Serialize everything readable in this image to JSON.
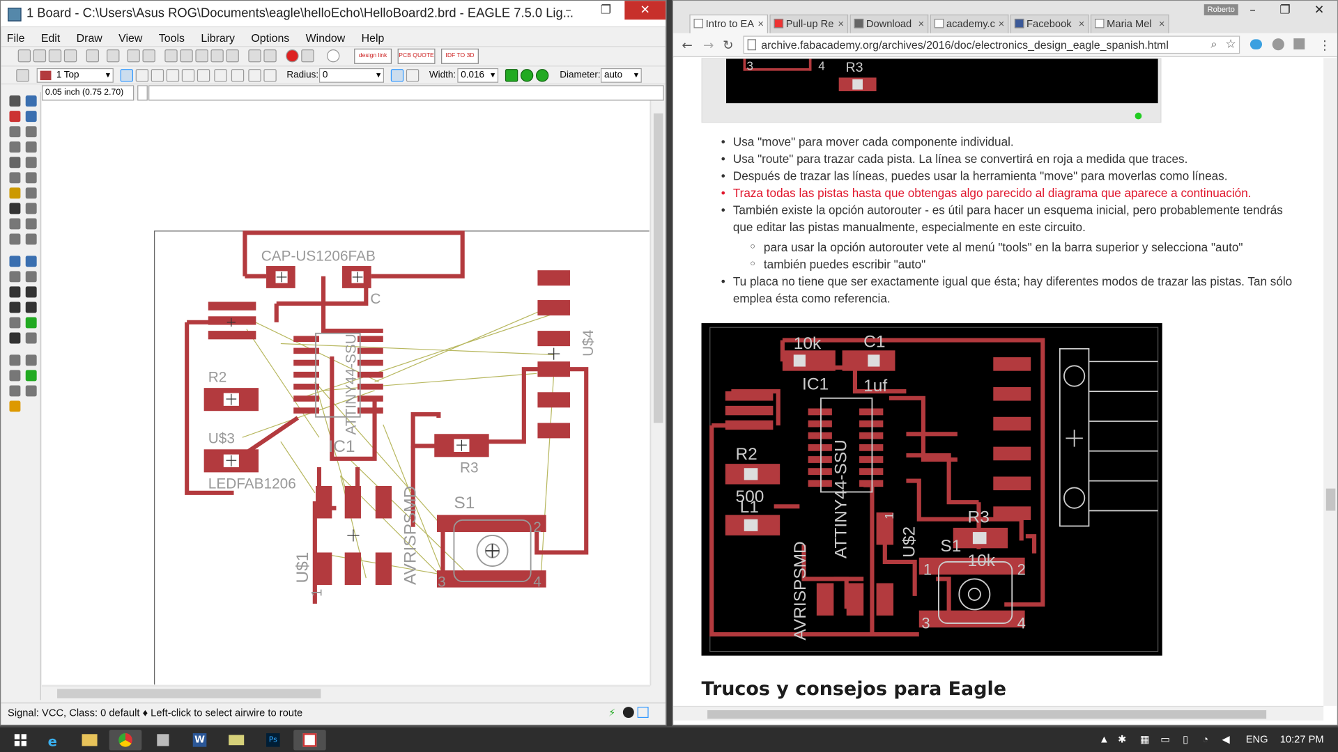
{
  "eagle": {
    "title": "1 Board - C:\\Users\\Asus ROG\\Documents\\eagle\\helloEcho\\HelloBoard2.brd - EAGLE 7.5.0 Lig...",
    "menu": [
      "File",
      "Edit",
      "Draw",
      "View",
      "Tools",
      "Library",
      "Options",
      "Window",
      "Help"
    ],
    "toolbar_buttons": [
      "design link",
      "PCB QUOTE",
      "IDF TO 3D"
    ],
    "layer": "1 Top",
    "radius_label": "Radius:",
    "radius_value": "0",
    "width_label": "Width:",
    "width_value": "0.016",
    "diameter_label": "Diameter:",
    "diameter_value": "auto",
    "coord": "0.05 inch (0.75 2.70)",
    "status": "Signal: VCC, Class: 0 default  ♦ Left-click to select airwire to route",
    "board_labels": {
      "cap_name": "CAP-US1206FAB",
      "c_name": "C",
      "r2": "R2",
      "u3": "U$3",
      "led": "LEDFAB1206",
      "ic1": "IC1",
      "attiny": "ATTINY44-SSU",
      "u4": "U$4",
      "r3": "R3",
      "s1": "S1",
      "avr": "AVRISPSMD",
      "u1": "U$1",
      "one": "1",
      "pin2": "2",
      "pin3": "3",
      "pin4": "4"
    },
    "colors": {
      "trace": "#b33a3e",
      "airwire": "#b8b860"
    }
  },
  "chrome": {
    "tabs": [
      {
        "label": "Intro to EA",
        "active": true,
        "fav": "page-icon"
      },
      {
        "label": "Pull-up Re",
        "active": false,
        "fav": "sparkfun-icon"
      },
      {
        "label": "Download",
        "active": false,
        "fav": "download-icon"
      },
      {
        "label": "academy.c",
        "active": false,
        "fav": "page-icon"
      },
      {
        "label": "Facebook",
        "active": false,
        "fav": "facebook-icon"
      },
      {
        "label": "Maria Mel",
        "active": false,
        "fav": "page-icon"
      }
    ],
    "profile": "Roberto",
    "url": "archive.fabacademy.org/archives/2016/doc/electronics_design_eagle_spanish.html",
    "top_image_label": "R3",
    "top_image_pins": [
      "3",
      "4"
    ],
    "bullets": [
      {
        "text": "Usa \"move\" para mover cada componente individual.",
        "red": false
      },
      {
        "text": "Usa \"route\" para trazar cada pista. La línea se convertirá en roja a medida que traces.",
        "red": false
      },
      {
        "text": "Después de trazar las líneas, puedes usar la herramienta \"move\" para moverlas como líneas.",
        "red": false
      },
      {
        "text": "Traza todas las pistas hasta que obtengas algo parecido al diagrama que aparece a continuación.",
        "red": true
      },
      {
        "text": "También existe la opción autorouter - es útil para hacer un esquema inicial, pero probablemente tendrás",
        "red": false
      },
      {
        "text": "que editar las pistas manualmente, especialmente en este circuito.",
        "red": false,
        "cont": true
      }
    ],
    "sub_bullets": [
      "para usar la opción autorouter vete al menú \"tools\" en la barra superior y selecciona \"auto\"",
      "también puedes escribir \"auto\""
    ],
    "bullets2": [
      {
        "text": "Tu placa no tiene que ser exactamente igual que ésta; hay diferentes modos de trazar las pistas. Tan sólo"
      },
      {
        "text": "emplea ésta como referencia.",
        "cont": true
      }
    ],
    "diagram_labels": {
      "k10": "10k",
      "c1": "C1",
      "ic1": "IC1",
      "uf1": "1uf",
      "r2": "R2",
      "v500": "500",
      "l1": "L1",
      "attiny": "ATTINY44-SSU",
      "avr": "AVRISPSMD",
      "u2": "U$2",
      "r3": "R3",
      "s1": "S1",
      "k10b": "10k",
      "one": "1",
      "p1": "1",
      "p2": "2",
      "p3": "3",
      "p4": "4"
    },
    "heading": "Trucos y consejos para Eagle"
  },
  "taskbar": {
    "lang": "ENG",
    "time": "10:27 PM",
    "apps": [
      "start-icon",
      "ie-icon",
      "explorer-icon",
      "chrome-icon",
      "app-icon",
      "word-icon",
      "folder-icon",
      "photoshop-icon",
      "eagle-icon"
    ]
  }
}
